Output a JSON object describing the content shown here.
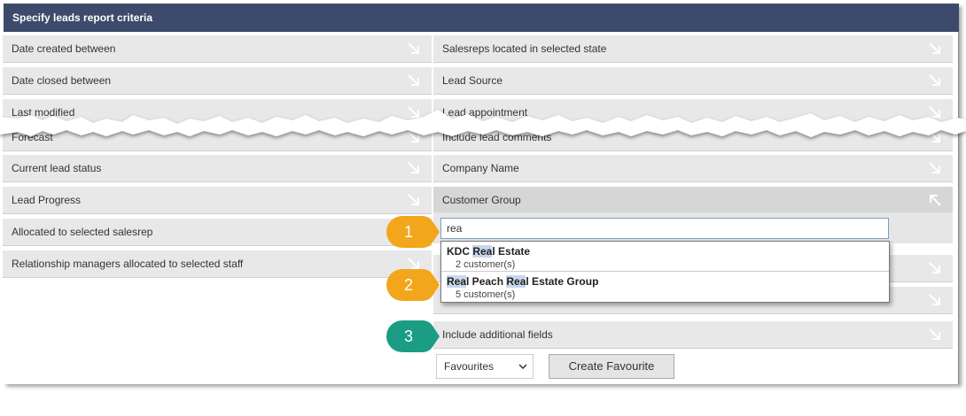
{
  "header": {
    "title": "Specify leads report criteria"
  },
  "left_rows": [
    {
      "label": "Date created between"
    },
    {
      "label": "Date closed between"
    },
    {
      "label": "Last modified"
    },
    {
      "label": "Forecast"
    },
    {
      "label": "Current lead status"
    },
    {
      "label": "Lead Progress"
    },
    {
      "label": "Allocated to selected salesrep"
    },
    {
      "label": "Relationship managers allocated to selected staff"
    }
  ],
  "right_rows": [
    {
      "label": "Salesreps located in selected state"
    },
    {
      "label": "Lead Source"
    },
    {
      "label": "Lead appointment"
    },
    {
      "label": "Include lead comments"
    },
    {
      "label": "Company Name"
    },
    {
      "label": "Customer Group"
    },
    {
      "label": "Include additional fields"
    }
  ],
  "search": {
    "value": "rea"
  },
  "dropdown": [
    {
      "prefix": "KDC ",
      "hl1": "Rea",
      "mid": "l Estate",
      "hl2": "",
      "rest": "",
      "count": "2 customer(s)"
    },
    {
      "prefix": "",
      "hl1": "Rea",
      "mid": "l Peach ",
      "hl2": "Rea",
      "rest": "l Estate Group",
      "count": "5 customer(s)"
    }
  ],
  "callouts": [
    "1",
    "2",
    "3"
  ],
  "footer": {
    "favourites_select": "Favourites",
    "create_favourite": "Create Favourite"
  },
  "colors": {
    "header_bg": "#3c4a6b",
    "callout_orange": "#f2a61c",
    "callout_green": "#1a9d84"
  }
}
